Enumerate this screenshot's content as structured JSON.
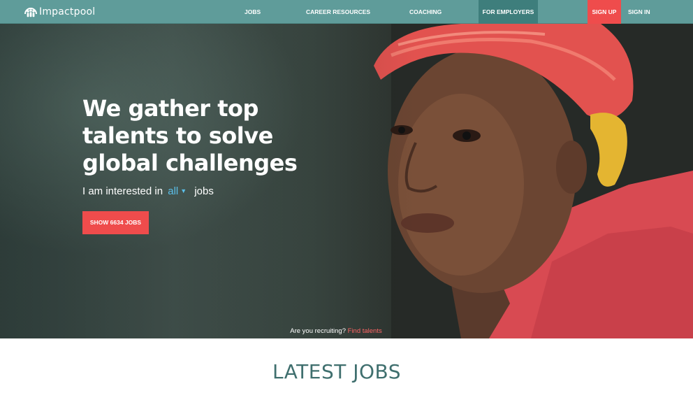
{
  "brand": {
    "name": "Impactpool"
  },
  "nav": {
    "jobs": "JOBS",
    "career_resources": "CAREER RESOURCES",
    "coaching": "COACHING",
    "for_employers": "FOR EMPLOYERS",
    "sign_up": "SIGN UP",
    "sign_in": "SIGN IN"
  },
  "hero": {
    "headline": "We gather top talents to solve global challenges",
    "interest_prefix": "I am interested in",
    "interest_value": "all",
    "interest_suffix": "jobs",
    "cta": "SHOW 6634 JOBS",
    "recruit_text": "Are you recruiting?",
    "recruit_link": "Find talents"
  },
  "sections": {
    "latest_jobs": "LATEST JOBS"
  },
  "colors": {
    "nav_bg": "#5f9c9a",
    "nav_active": "#3e7e7c",
    "accent_red": "#ef4c4c",
    "link_blue": "#5bbfe9",
    "heading_teal": "#3f6f6e"
  }
}
